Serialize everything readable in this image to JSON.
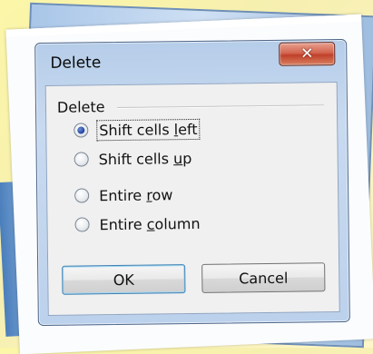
{
  "dialog": {
    "title": "Delete",
    "close_symbol": "✕",
    "group_label": "Delete",
    "options": [
      {
        "pre": "Shift cells ",
        "key": "l",
        "post": "eft",
        "checked": true
      },
      {
        "pre": "Shift cells ",
        "key": "u",
        "post": "p",
        "checked": false
      },
      {
        "pre": "Entire ",
        "key": "r",
        "post": "ow",
        "checked": false
      },
      {
        "pre": "Entire ",
        "key": "c",
        "post": "olumn",
        "checked": false
      }
    ],
    "ok_label": "OK",
    "cancel_label": "Cancel"
  },
  "icons": {
    "close": "close-icon",
    "radio": "radio-button"
  },
  "colors": {
    "titlebar": "#c0d4ee",
    "close_button": "#c7402a",
    "radio_selected": "#1d3f9e",
    "default_button_border": "#3c7fb1"
  }
}
